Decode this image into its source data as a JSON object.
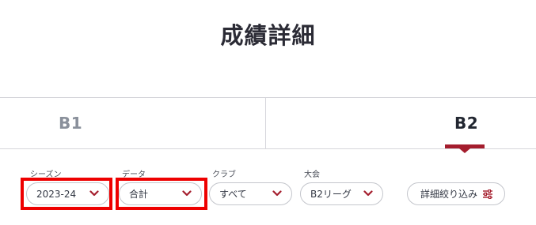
{
  "page": {
    "title": "成績詳細"
  },
  "tabs": [
    {
      "label": "B1",
      "active": false
    },
    {
      "label": "B2",
      "active": true
    }
  ],
  "filters": {
    "season": {
      "label": "シーズン",
      "value": "2023-24"
    },
    "data": {
      "label": "データ",
      "value": "合計"
    },
    "club": {
      "label": "クラブ",
      "value": "すべて"
    },
    "tournament": {
      "label": "大会",
      "value": "B2リーグ"
    }
  },
  "detail_filter": {
    "label": "詳細絞り込み"
  },
  "colors": {
    "accent": "#a41d2d",
    "highlight": "#ee0000",
    "text": "#2b2b35",
    "muted_tab": "#8a909b"
  },
  "icons": {
    "chevron": "chevron-down-icon",
    "filter": "filter-sliders-icon"
  }
}
